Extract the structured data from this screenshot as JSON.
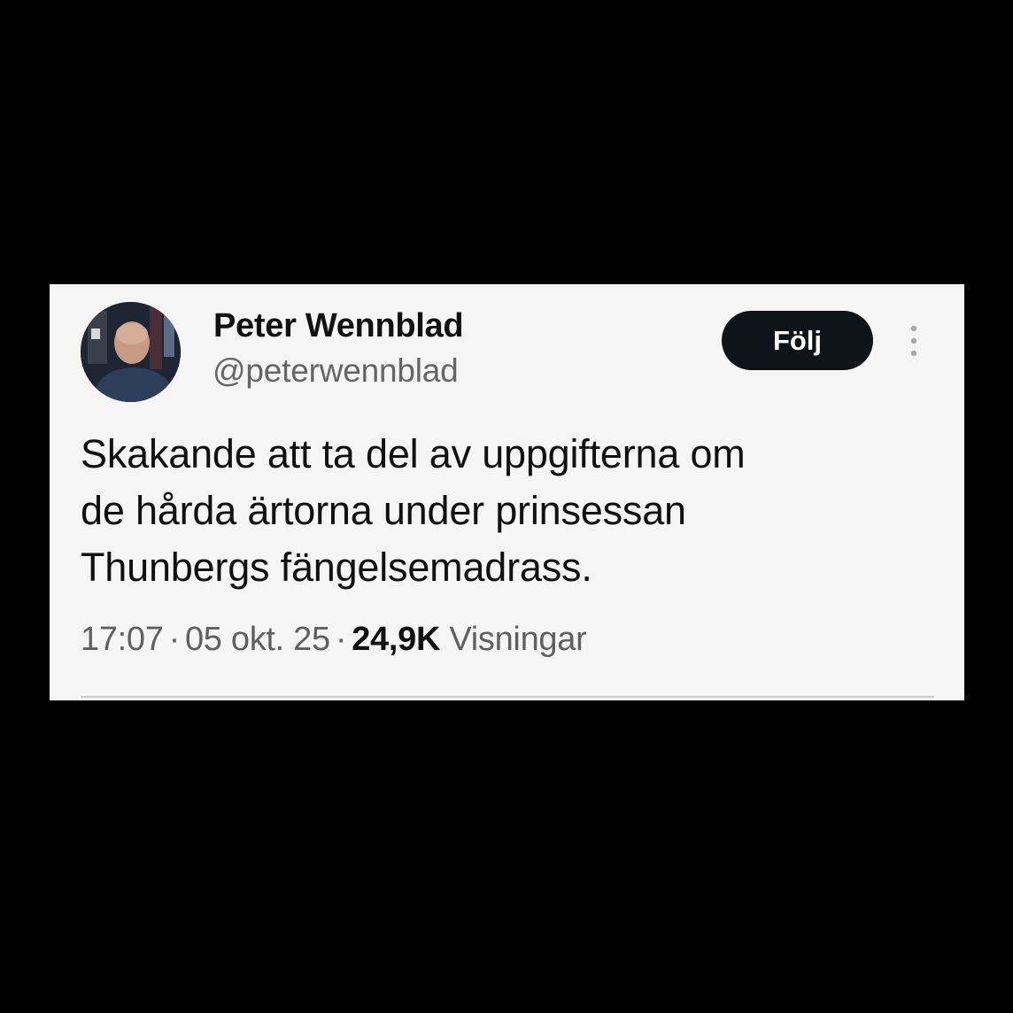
{
  "tweet": {
    "author": {
      "display_name": "Peter Wennblad",
      "handle": "@peterwennblad"
    },
    "follow_label": "Följ",
    "text_lines": [
      "Skakande att ta del av uppgifterna om",
      "de hårda ärtorna under prinsessan",
      "Thunbergs fängelsemadrass."
    ],
    "meta": {
      "time": "17:07",
      "separator": "·",
      "date": "05 okt. 25",
      "views_count": "24,9K",
      "views_label": "Visningar"
    }
  },
  "icons": {
    "more": "more-vertical-icon",
    "avatar": "profile-photo"
  },
  "colors": {
    "page_background": "#000000",
    "card_background": "#f5f5f5",
    "follow_button": "#0f1419",
    "secondary_text": "#656565"
  }
}
